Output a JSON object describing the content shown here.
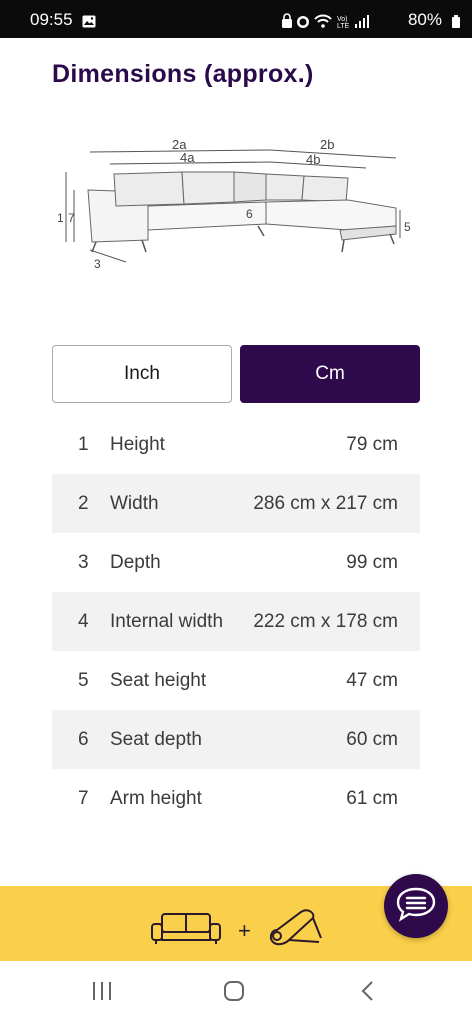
{
  "status_bar": {
    "time": "09:55",
    "battery": "80%",
    "icons": [
      "gallery-icon",
      "lock-icon",
      "alarm-icon",
      "wifi-icon",
      "volte-icon",
      "signal-icon",
      "battery-icon"
    ]
  },
  "page": {
    "title": "Dimensions (approx.)"
  },
  "diagram": {
    "labels": {
      "l2a": "2a",
      "l2b": "2b",
      "l4a": "4a",
      "l4b": "4b",
      "l1": "1",
      "l7": "7",
      "l3": "3",
      "l5": "5",
      "l6": "6"
    }
  },
  "unit_toggle": {
    "inch_label": "Inch",
    "cm_label": "Cm",
    "selected": "Cm"
  },
  "dimensions": [
    {
      "num": "1",
      "label": "Height",
      "value": "79 cm"
    },
    {
      "num": "2",
      "label": "Width",
      "value": "286 cm x 217 cm"
    },
    {
      "num": "3",
      "label": "Depth",
      "value": "99 cm"
    },
    {
      "num": "4",
      "label": "Internal width",
      "value": "222 cm x 178 cm"
    },
    {
      "num": "5",
      "label": "Seat height",
      "value": "47 cm"
    },
    {
      "num": "6",
      "label": "Seat depth",
      "value": "60 cm"
    },
    {
      "num": "7",
      "label": "Arm height",
      "value": "61 cm"
    }
  ],
  "bottom_bar": {
    "plus": "+",
    "icons": [
      "sofa-icon",
      "rug-icon"
    ]
  },
  "colors": {
    "brand_purple": "#2e0a4d",
    "accent_yellow": "#fad04a"
  }
}
